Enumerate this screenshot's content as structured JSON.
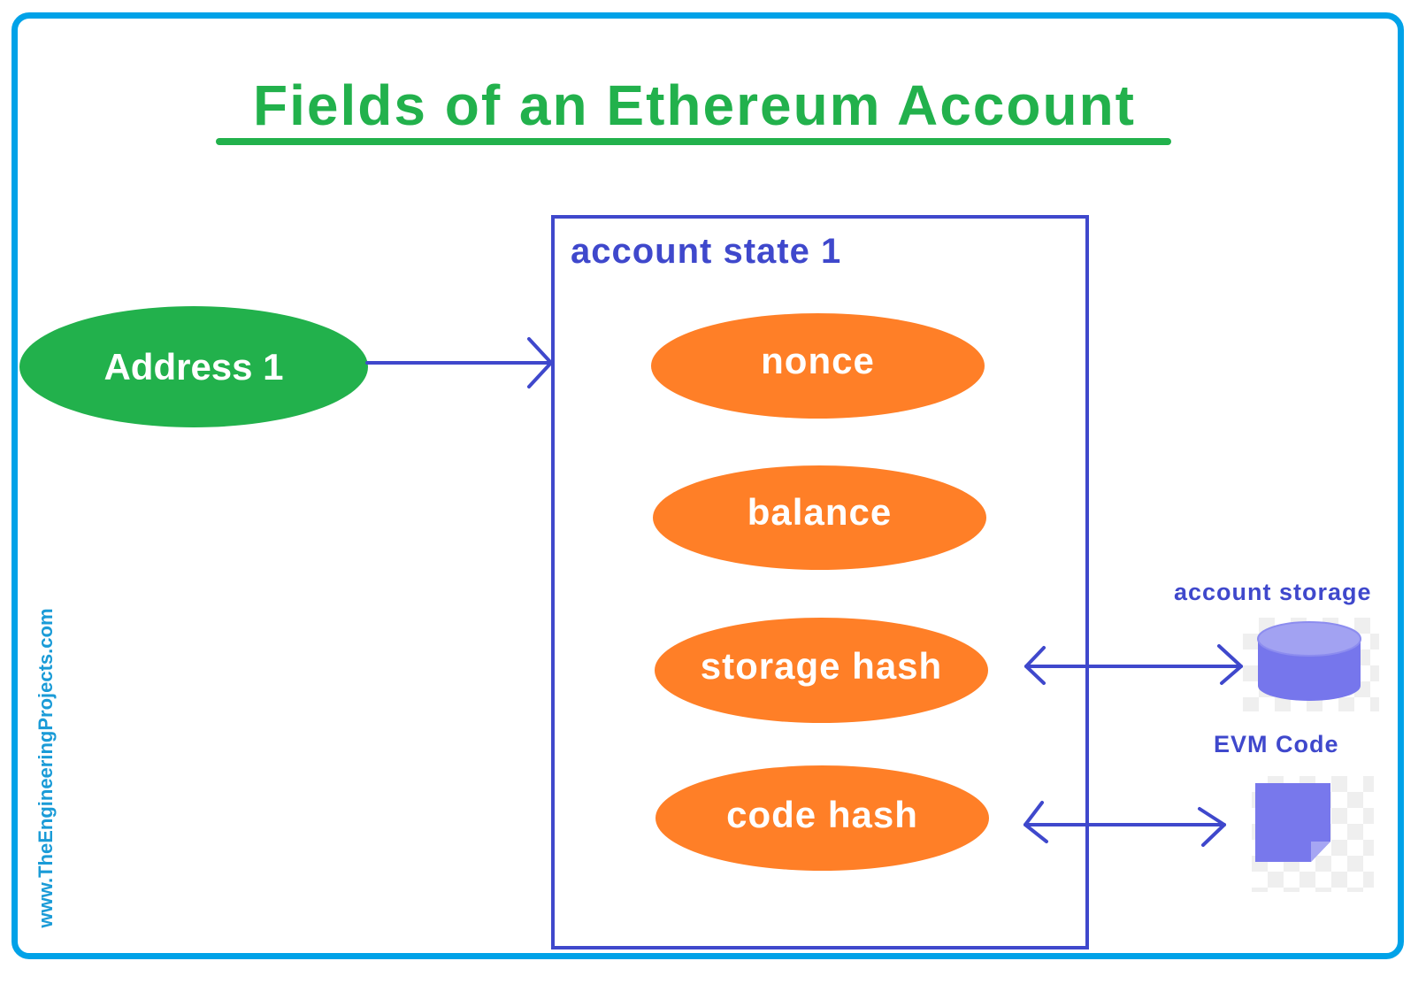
{
  "title": "Fields of an Ethereum Account",
  "watermark": "www.TheEngineeringProjects.com",
  "address": {
    "label": "Address 1"
  },
  "account_state": {
    "label": "account state 1",
    "fields": [
      {
        "label": "nonce"
      },
      {
        "label": "balance"
      },
      {
        "label": "storage hash"
      },
      {
        "label": "code hash"
      }
    ]
  },
  "external": {
    "account_storage": {
      "label": "account storage",
      "icon": "database-icon"
    },
    "evm_code": {
      "label": "EVM Code",
      "icon": "document-icon"
    }
  },
  "colors": {
    "frame": "#00a2e8",
    "title": "#22b14c",
    "address_fill": "#22b14c",
    "field_fill": "#ff7f27",
    "connector": "#3f48cc",
    "icon_fill": "#7878ec",
    "watermark": "#1a9bd7"
  }
}
